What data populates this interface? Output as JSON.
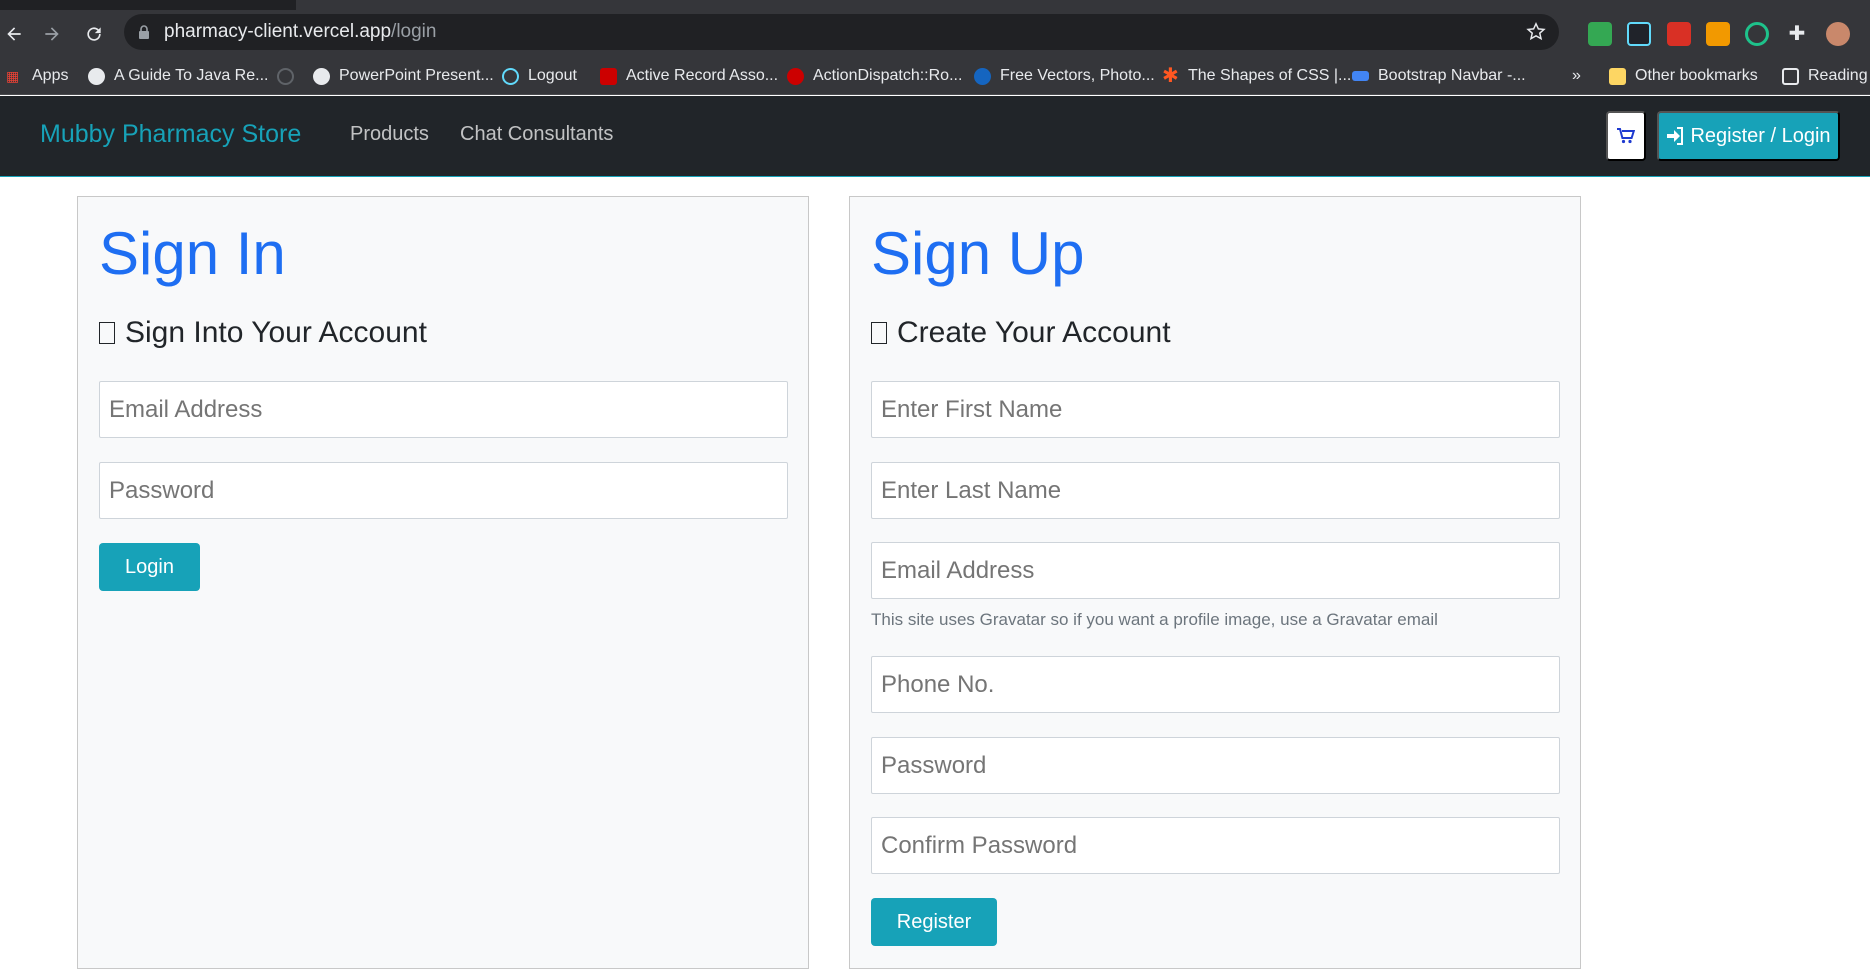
{
  "browser": {
    "url_host": "pharmacy-client.vercel.app",
    "url_path": "/login",
    "bookmarks": [
      {
        "label": "Apps",
        "color": "#34a853"
      },
      {
        "label": "A Guide To Java Re...",
        "color": "#e8eaed"
      },
      {
        "label": "PowerPoint Present...",
        "color": "#e8eaed"
      },
      {
        "label": "Logout",
        "color": "#61dafb"
      },
      {
        "label": "Active Record Asso...",
        "color": "#cc0000"
      },
      {
        "label": "ActionDispatch::Ro...",
        "color": "#cc0000"
      },
      {
        "label": "Free Vectors, Photo...",
        "color": "#1565c0"
      },
      {
        "label": "The Shapes of CSS |...",
        "color": "#ff5722"
      },
      {
        "label": "Bootstrap Navbar -...",
        "color": "#4285f4"
      }
    ],
    "overflow_chevron": "»",
    "other_bookmarks": "Other bookmarks",
    "reading_list": "Reading"
  },
  "navbar": {
    "brand": "Mubby Pharmacy Store",
    "links": [
      "Products",
      "Chat Consultants"
    ],
    "cart_icon": "cart-icon",
    "auth_label": "Register / Login"
  },
  "signin": {
    "title": "Sign In",
    "lead": "Sign Into Your Account",
    "email_placeholder": "Email Address",
    "password_placeholder": "Password",
    "submit": "Login"
  },
  "signup": {
    "title": "Sign Up",
    "lead": "Create Your Account",
    "first_name_placeholder": "Enter First Name",
    "last_name_placeholder": "Enter Last Name",
    "email_placeholder": "Email Address",
    "gravatar_hint": "This site uses Gravatar so if you want a profile image, use a Gravatar email",
    "phone_placeholder": "Phone No.",
    "password_placeholder": "Password",
    "confirm_placeholder": "Confirm Password",
    "submit": "Register"
  },
  "colors": {
    "accent": "#17a2b8",
    "heading": "#1e6ef2",
    "navbar_bg": "#212529"
  }
}
